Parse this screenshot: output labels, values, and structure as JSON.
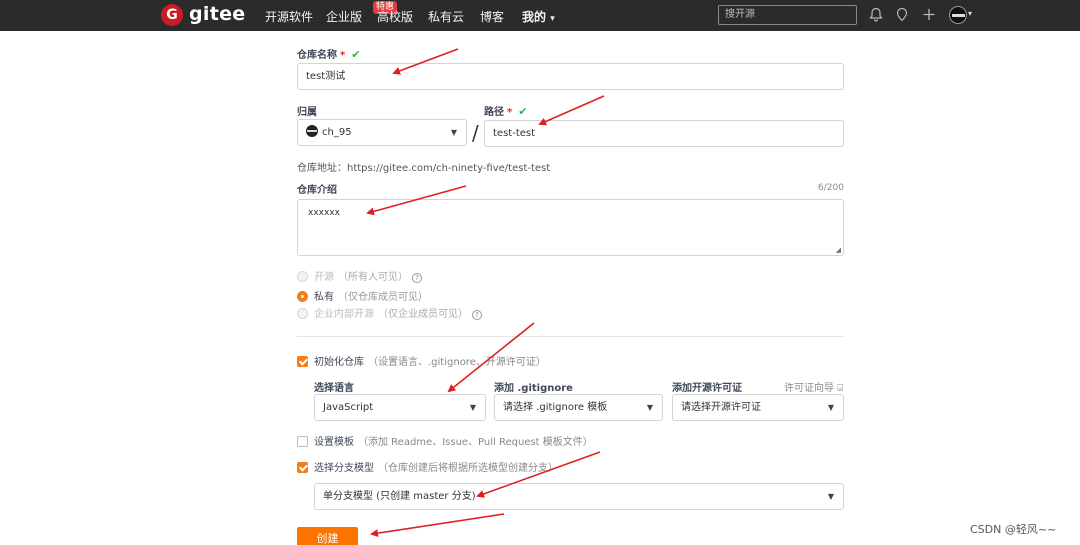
{
  "nav": {
    "brand": "gitee",
    "logo_letter": "G",
    "items": [
      "开源软件",
      "企业版",
      "高校版",
      "私有云",
      "博客"
    ],
    "hot_badge": "特惠",
    "mine": "我的",
    "search_placeholder": "搜开源"
  },
  "form": {
    "repo_name": {
      "label": "仓库名称",
      "required": "*",
      "value": "test测试"
    },
    "owner": {
      "label": "归属",
      "value": "ch_95"
    },
    "path": {
      "label": "路径",
      "required": "*",
      "value": "test-test"
    },
    "repo_address": "仓库地址：https://gitee.com/ch-ninety-five/test-test",
    "intro": {
      "label": "仓库介绍",
      "counter": "6/200",
      "value": "xxxxxx"
    },
    "visibility": [
      {
        "label": "开源",
        "hint": "（所有人可见）",
        "selected": false
      },
      {
        "label": "私有",
        "hint": "（仅仓库成员可见）",
        "selected": true
      },
      {
        "label": "企业内部开源",
        "hint": "（仅企业成员可见）",
        "selected": false
      }
    ],
    "init_repo": {
      "label": "初始化仓库",
      "hint": "（设置语言、.gitignore、开源许可证）",
      "checked": true
    },
    "language": {
      "label": "选择语言",
      "value": "JavaScript"
    },
    "gitignore": {
      "label": "添加 .gitignore",
      "value": "请选择 .gitignore 模板"
    },
    "license": {
      "label": "添加开源许可证",
      "value": "请选择开源许可证",
      "guide": "许可证向导"
    },
    "template": {
      "label": "设置模板",
      "hint": "（添加 Readme、Issue、Pull Request 模板文件）",
      "checked": false
    },
    "branch_model": {
      "label": "选择分支模型",
      "hint": "（仓库创建后将根据所选模型创建分支）",
      "checked": true,
      "value": "单分支模型 (只创建 master 分支)"
    },
    "create_button": "创建"
  },
  "watermark": "CSDN @轻风~~",
  "colors": {
    "accent": "#fe7300",
    "navbar": "#2b2b2b",
    "arrow": "#e02020",
    "check": "#21ba45"
  }
}
